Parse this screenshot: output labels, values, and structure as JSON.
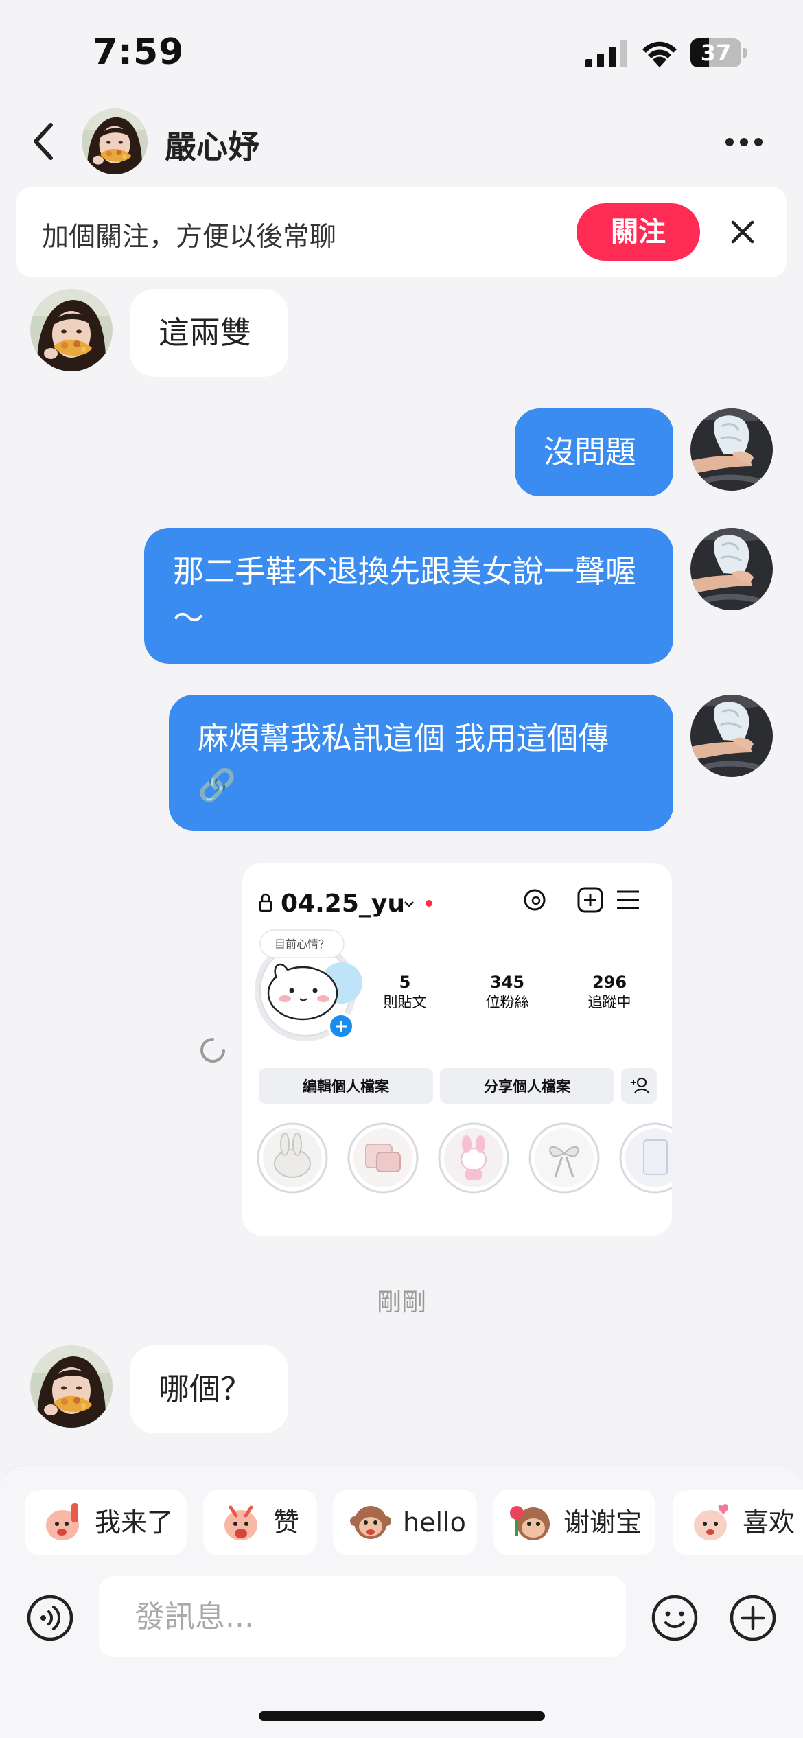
{
  "status_bar": {
    "time": "7:59",
    "battery": "37",
    "battery_level": 0.37
  },
  "header": {
    "name": "嚴心妤",
    "back_icon": "chevron-left-icon",
    "more_icon": "ellipsis-icon"
  },
  "follow_banner": {
    "text": "加個關注，方便以後常聊",
    "button": "關注",
    "close_icon": "close-icon"
  },
  "messages": [
    {
      "side": "in",
      "text": "這兩雙"
    },
    {
      "side": "out",
      "text": "沒問題"
    },
    {
      "side": "out",
      "text": "那二手鞋不退換先跟美女說一聲喔～"
    },
    {
      "side": "out",
      "text": "麻煩幫我私訊這個 我用這個傳🔗"
    },
    {
      "side": "in",
      "text": "哪個？"
    }
  ],
  "shared_profile": {
    "username": "04.25_yu",
    "note": "目前心情？",
    "stats": [
      {
        "value": "5",
        "label": "則貼文"
      },
      {
        "value": "345",
        "label": "位粉絲"
      },
      {
        "value": "296",
        "label": "追蹤中"
      }
    ],
    "buttons": [
      "編輯個人檔案",
      "分享個人檔案"
    ],
    "highlight_icons": [
      "bunny-plush",
      "pink-pillows",
      "my-melody-plush",
      "ribbon-bow",
      "photo-card"
    ]
  },
  "timestamp": "剛剛",
  "quick_replies": [
    {
      "label": "我来了",
      "sticker": "waving-sticker"
    },
    {
      "label": "赞",
      "sticker": "thumbs-sticker"
    },
    {
      "label": "hello",
      "sticker": "monkey-sticker"
    },
    {
      "label": "谢谢宝",
      "sticker": "flower-sticker"
    },
    {
      "label": "喜欢",
      "sticker": "heart-sticker"
    }
  ],
  "composer": {
    "placeholder": "發訊息...",
    "voice_icon": "voice-icon",
    "emoji_icon": "emoji-icon",
    "plus_icon": "plus-icon"
  },
  "colors": {
    "outgoing_bubble": "#3b8cf0",
    "follow_button": "#fe2c55",
    "background": "#f4f4f6"
  }
}
